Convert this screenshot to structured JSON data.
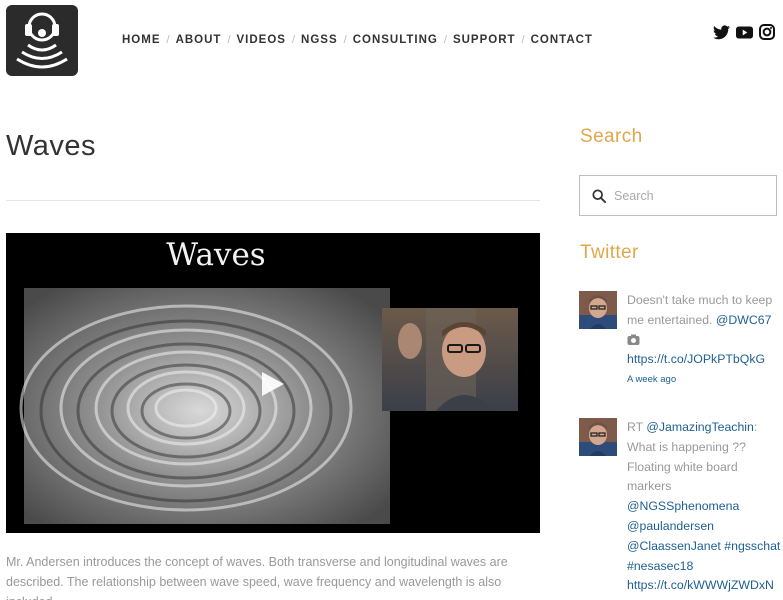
{
  "site": {
    "logo_name": "Bozeman Science headphones logo"
  },
  "nav": {
    "items": [
      "HOME",
      "ABOUT",
      "VIDEOS",
      "NGSS",
      "CONSULTING",
      "SUPPORT",
      "CONTACT"
    ],
    "separator": "/"
  },
  "social": {
    "icons": [
      "twitter-icon",
      "youtube-icon",
      "instagram-icon"
    ]
  },
  "page": {
    "title": "Waves"
  },
  "video": {
    "overlay_title": "Waves"
  },
  "description": "Mr. Andersen introduces the concept of waves. Both transverse and longitudinal waves are described. The relationship between wave speed, wave frequency and wavelength is also included.",
  "sidebar": {
    "search_heading": "Search",
    "search_placeholder": "Search",
    "twitter_heading": "Twitter",
    "tweets": [
      {
        "text": "Doesn't take much to keep me entertained.",
        "mention": "@DWC67",
        "link": "https://t.co/JOPkPTbQkG",
        "time": "A week ago"
      },
      {
        "prefix": "RT",
        "mention": "@JamazingTeachin",
        "text": ": What is happening ?? Floating white board markers",
        "mentions": [
          "@NGSSphenomena",
          "@paulandersen",
          "@ClaassenJanet"
        ],
        "hashtags": [
          "#ngsschat",
          "#nesasec18"
        ],
        "link": "https://t.co/kWWWjZWDxN"
      }
    ]
  },
  "colors": {
    "accent": "#e0a84b",
    "link": "#1e5f93",
    "muted": "#999999"
  }
}
